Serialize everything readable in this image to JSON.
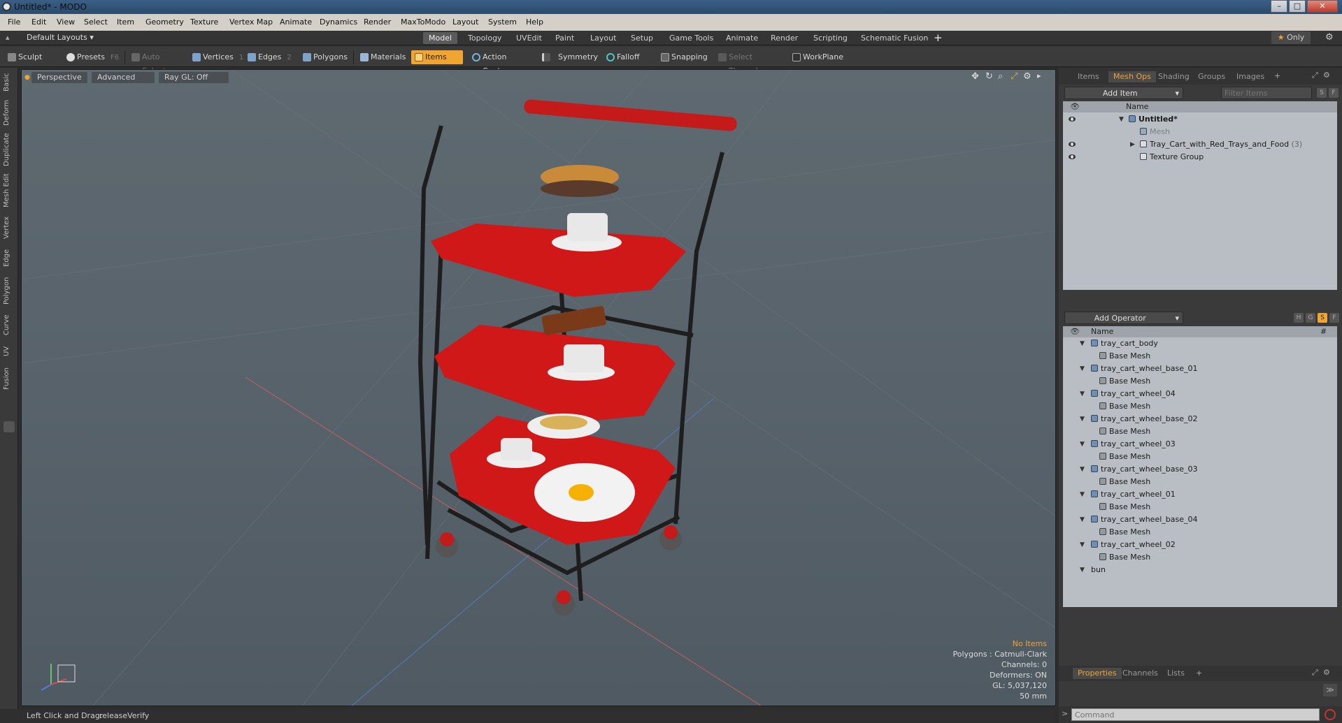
{
  "window": {
    "title": "Untitled* - MODO"
  },
  "menu": [
    "File",
    "Edit",
    "View",
    "Select",
    "Item",
    "Geometry",
    "Texture",
    "Vertex Map",
    "Animate",
    "Dynamics",
    "Render",
    "MaxToModo",
    "Layout",
    "System",
    "Help"
  ],
  "layouts": {
    "current": "Default Layouts",
    "tabs": [
      "Model",
      "Topology",
      "UVEdit",
      "Paint",
      "Layout",
      "Setup",
      "Game Tools",
      "Animate",
      "Render",
      "Scripting",
      "Schematic Fusion"
    ],
    "active_tab": "Model",
    "only_label": "Only"
  },
  "toolbar": {
    "sculpt": "Sculpt",
    "presets": "Presets",
    "presets_key": "F6",
    "auto_select": "Auto Select",
    "vertices": "Vertices",
    "vertices_key": "1",
    "edges": "Edges",
    "edges_key": "2",
    "polygons": "Polygons",
    "materials": "Materials",
    "items": "Items",
    "action_center": "Action Center",
    "symmetry": "Symmetry",
    "falloff": "Falloff",
    "snapping": "Snapping",
    "select_through": "Select Through",
    "workplane": "WorkPlane"
  },
  "left_tabs": [
    "Basic",
    "Deform",
    "Duplicate",
    "Mesh Edit",
    "Vertex",
    "Edge",
    "Polygon",
    "Curve",
    "UV",
    "Fusion"
  ],
  "viewport": {
    "view": "Perspective",
    "shading": "Advanced",
    "raygl": "Ray GL: Off",
    "info": {
      "selection": "No Items",
      "polygons": "Polygons : Catmull-Clark",
      "channels": "Channels: 0",
      "deformers": "Deformers: ON",
      "gl": "GL: 5,037,120",
      "scale": "50 mm"
    }
  },
  "status": {
    "label": "Left Click and Drag:",
    "value": "releaseVerify"
  },
  "items_panel": {
    "tabs": [
      "Items",
      "Mesh Ops",
      "Shading",
      "Groups",
      "Images"
    ],
    "active_tab": "Mesh Ops",
    "add_item": "Add Item",
    "filter_placeholder": "Filter Items",
    "col_name": "Name",
    "rows": [
      {
        "name": "Untitled*",
        "extra": ""
      },
      {
        "name": "Mesh",
        "extra": ""
      },
      {
        "name": "Tray_Cart_with_Red_Trays_and_Food",
        "extra": "(3)"
      },
      {
        "name": "Texture Group",
        "extra": ""
      }
    ]
  },
  "meshops_panel": {
    "add_operator": "Add Operator",
    "col_name": "Name",
    "col_hash": "#",
    "rows": [
      {
        "name": "tray_cart_body",
        "child": "Base Mesh"
      },
      {
        "name": "tray_cart_wheel_base_01",
        "child": "Base Mesh"
      },
      {
        "name": "tray_cart_wheel_04",
        "child": "Base Mesh"
      },
      {
        "name": "tray_cart_wheel_base_02",
        "child": "Base Mesh"
      },
      {
        "name": "tray_cart_wheel_03",
        "child": "Base Mesh"
      },
      {
        "name": "tray_cart_wheel_base_03",
        "child": "Base Mesh"
      },
      {
        "name": "tray_cart_wheel_01",
        "child": "Base Mesh"
      },
      {
        "name": "tray_cart_wheel_base_04",
        "child": "Base Mesh"
      },
      {
        "name": "tray_cart_wheel_02",
        "child": "Base Mesh"
      },
      {
        "name": "bun",
        "child": ""
      }
    ]
  },
  "bottom_panel": {
    "tabs": [
      "Properties",
      "Channels",
      "Lists"
    ],
    "active_tab": "Properties",
    "command_placeholder": "Command"
  }
}
